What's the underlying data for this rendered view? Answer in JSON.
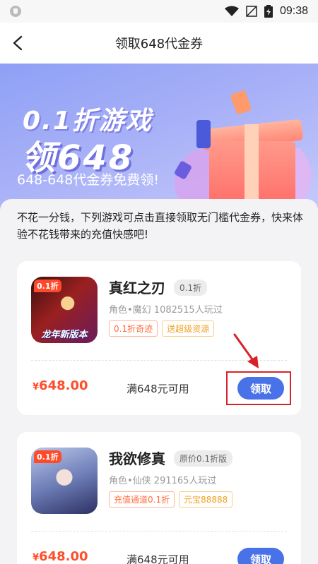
{
  "status": {
    "time": "09:38"
  },
  "header": {
    "title": "领取648代金券"
  },
  "banner": {
    "line1": "0.1折游戏",
    "line2": "领648",
    "line3": "648-648代金券免费领!"
  },
  "intro": "不花一分钱，下列游戏可点击直接领取无门槛代金券，快来体验不花钱带来的充值快感吧!",
  "games": [
    {
      "name": "真红之刃",
      "discount": "0.1折",
      "meta": "角色•魔幻   1082515人玩过",
      "tags": [
        "0.1折奇迹",
        "送超级资源"
      ],
      "icon_tag": "0.1折",
      "icon_caption": "龙年新版本",
      "currency": "¥",
      "price": "648.00",
      "condition": "满648元可用",
      "button": "领取"
    },
    {
      "name": "我欲修真",
      "discount": "原价0.1折版",
      "meta": "角色•仙侠   291165人玩过",
      "tags": [
        "充值通道0.1折",
        "元宝88888"
      ],
      "icon_tag": "0.1折",
      "currency": "¥",
      "price": "648.00",
      "condition": "满648元可用",
      "button": "领取"
    }
  ],
  "colors": {
    "accent": "#4a72e8",
    "price": "#ff4e2a",
    "annotation": "#d8222a"
  }
}
